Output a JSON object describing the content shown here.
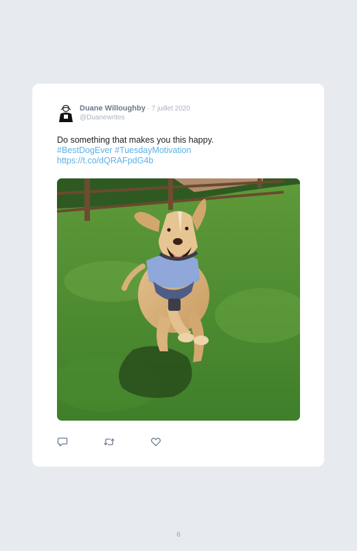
{
  "tweet": {
    "author_name": "Duane Willoughby",
    "date_separator": " · ",
    "date": "7 juillet 2020",
    "handle": "@Duanewrites",
    "text": "Do something that makes you this happy.",
    "hashtags": "#BestDogEver #TuesdayMotivation",
    "url": "https://t.co/dQRAFpdG4b",
    "photo_alt": "Dog running happily on grass"
  },
  "actions": [
    {
      "icon": "reply-icon"
    },
    {
      "icon": "retweet-icon"
    },
    {
      "icon": "like-icon"
    }
  ],
  "footer": {
    "page_number": "6"
  },
  "colors": {
    "background": "#e7eaef",
    "card": "#ffffff",
    "link": "#5ab1e5",
    "name": "#6b7a8c",
    "muted": "#a9b3bf"
  }
}
